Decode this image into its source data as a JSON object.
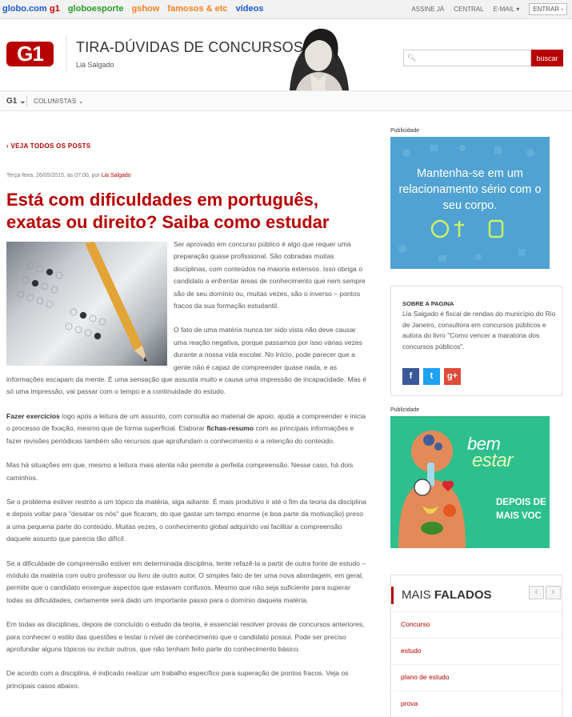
{
  "topbar": {
    "brand": "globo.com",
    "sites": [
      {
        "label": "g1",
        "color": "#cc0000"
      },
      {
        "label": "globoesporte",
        "color": "#2a9d2a"
      },
      {
        "label": "gshow",
        "color": "#f58220"
      },
      {
        "label": "famosos & etc",
        "color": "#f5821f"
      },
      {
        "label": "vídeos",
        "color": "#1a5bd1"
      }
    ],
    "assine": "ASSINE JÁ",
    "central": "CENTRAL",
    "email": "E-MAIL ▾",
    "entrar": "ENTRAR ›"
  },
  "header": {
    "logo": "G1",
    "blog_title": "TIRA-DÚVIDAS DE CONCURSOS",
    "author": "Lia Salgado",
    "search_placeholder": "",
    "search_button": "buscar"
  },
  "nav": {
    "g1": "G1 ⌄",
    "colunistas": "COLUNISTAS ⌄"
  },
  "post": {
    "back": "‹ VEJA TODOS OS POSTS",
    "meta_date": "Terça-feira, 26/05/2015, às 07:00, por ",
    "meta_author": "Lia Salgado",
    "title": "Está com dificuldades em português, exatas ou direito? Saiba como estudar",
    "p1": "Ser aprovado em concurso público é algo que requer uma preparação quase profissional. São cobradas muitas disciplinas, com conteúdos na maioria extensos. Isso obriga o candidato a enfrentar áreas de conhecimento que nem sempre são de seu domínio ou, muitas vezes, são o inverso – pontos fracos da sua formação estudantil.",
    "p2": "O fato de uma matéria nunca ter sido vista não deve causar uma reação negativa, porque passamos por isso várias vezes durante a nossa vida escolar. No início, pode parecer que a gente não é capaz de compreender quase nada, e as informações escapam da mente. É uma sensação que assusta muito e causa uma impressão de incapacidade. Mas é só uma impressão, vai passar com o tempo e a continuidade do estudo.",
    "p3_bold1": "Fazer exercícios",
    "p3_a": " logo após a leitura de um assunto, com consulta ao material de apoio, ajuda a compreender e inicia o processo de fixação, mesmo que de forma superficial. Elaborar ",
    "p3_bold2": "fichas-resumo",
    "p3_b": " com as principais informações e fazer revisões periódicas também são recursos que aprofundam o conhecimento e a retenção do conteúdo.",
    "p4": "Mas há situações em que, mesmo a leitura mais atenta não permite a perfeita compreensão. Nesse caso, há dois caminhos.",
    "p5": "Se o problema estiver restrito a um tópico da matéria, siga adiante. É mais produtivo ir até o fim da teoria da disciplina e depois voltar para \"desatar os nós\" que ficaram, do que gastar um tempo enorme (e boa parte da motivação) preso a uma pequena parte do conteúdo. Muitas vezes, o conhecimento global adquirido vai facilitar a compreensão daquele assunto que parecia tão difícil.",
    "p6": "Se a dificuldade de compreensão estiver em determinada disciplina, tente refazê-la a partir de outra fonte de estudo – módulo da matéria com outro professor ou livro de outro autor. O simples fato de ter uma nova abordagem, em geral, permite que o candidato enxergue aspectos que estavam confusos. Mesmo que não seja suficiente para superar todas as dificuldades, certamente será dado um importante passo para o domínio daquela matéria.",
    "p7": "Em todas as disciplinas, depois de concluído o estudo da teoria, é essencial resolver provas de concursos anteriores, para conhecer o estilo das questões e testar o nível de conhecimento que o candidato possui. Pode ser preciso aprofundar alguns tópicos ou incluir outros, que não tenham feito parte do conhecimento básico.",
    "p8": "De acordo com a disciplina, é indicado realizar um trabalho específico para superação de pontos fracos. Veja os principais casos abaixo."
  },
  "sidebar": {
    "publicidade": "Publicidade",
    "ad1_text": "Mantenha-se em um relacionamento sério com o seu corpo.",
    "about_heading": "SOBRE A PAGINA",
    "about_text": "Lia Salgado é fiscal de rendas do município do Rio de Janeiro, consultora em concursos públicos e autora do livro \"Como vencer a maratona dos concursos públicos\".",
    "social": [
      "f",
      "t",
      "g+"
    ],
    "ad2_bem": "bem",
    "ad2_estar": "estar",
    "ad2_depois": "DEPOIS DE",
    "ad2_mais": "MAIS VOC",
    "mais_light": "MAIS ",
    "mais_bold": "FALADOS",
    "mais_items": [
      "Concurso",
      "estudo",
      "plano de estudo",
      "prova"
    ]
  },
  "colors": {
    "brand_red": "#b80000",
    "ad_blue": "#4fa2d2",
    "ad_green": "#2dbf8e",
    "facebook": "#3b5998",
    "twitter": "#1da1f2",
    "gplus": "#dd4b39"
  }
}
